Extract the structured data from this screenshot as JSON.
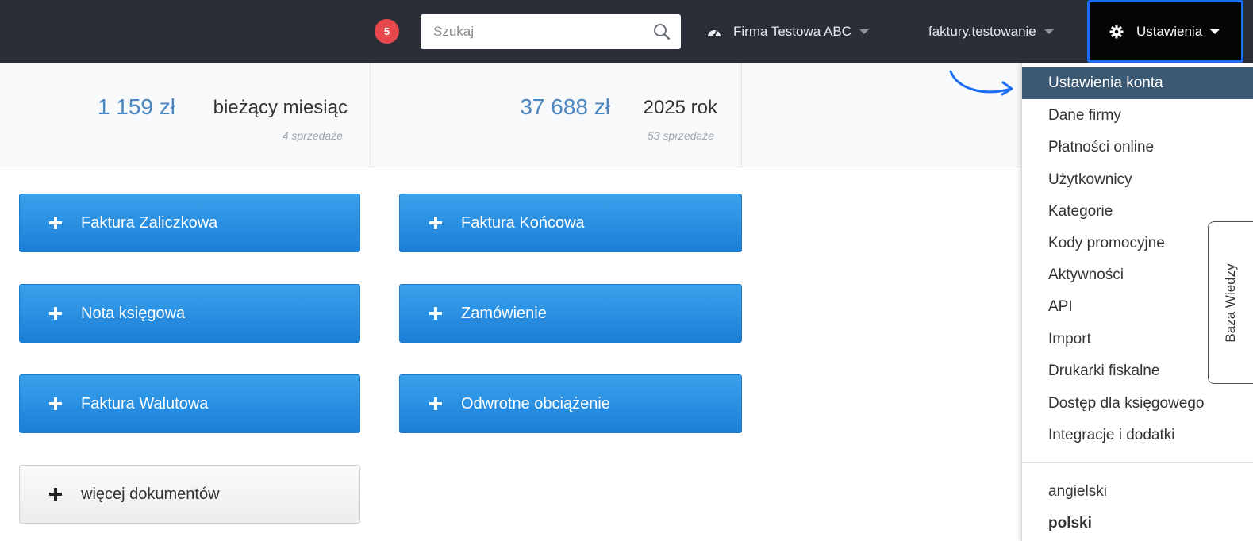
{
  "header": {
    "notification_count": "5",
    "search_placeholder": "Szukaj",
    "company": "Firma Testowa ABC",
    "account": "faktury.testowanie",
    "settings": "Ustawienia"
  },
  "stats": [
    {
      "amount": "1 159 zł",
      "label": "bieżący miesiąc",
      "count": "4 sprzedaże"
    },
    {
      "amount": "37 688 zł",
      "label": "2025 rok",
      "count": "53 sprzedaże"
    }
  ],
  "buttons": {
    "faktura_zaliczkowa": "Faktura Zaliczkowa",
    "faktura_koncowa": "Faktura Końcowa",
    "nota_ksiegowa": "Nota księgowa",
    "zamowienie": "Zamówienie",
    "faktura_walutowa": "Faktura Walutowa",
    "odwrotne_obciazenie": "Odwrotne obciążenie",
    "wiecej_dokumentow": "więcej dokumentów"
  },
  "menu": {
    "items": [
      "Ustawienia konta",
      "Dane firmy",
      "Płatności online",
      "Użytkownicy",
      "Kategorie",
      "Kody promocyjne",
      "Aktywności",
      "API",
      "Import",
      "Drukarki fiskalne",
      "Dostęp dla księgowego",
      "Integracje i dodatki"
    ],
    "languages": [
      "angielski",
      "polski"
    ]
  },
  "side_tab": "Baza Wiedzy",
  "colors": {
    "topbar": "#2a2f37",
    "primary_button": "#2b8ee2",
    "menu_active": "#3b5973",
    "highlight_border": "#1b6ef3",
    "stat_amount": "#4b86c0",
    "badge": "#e8474d"
  }
}
